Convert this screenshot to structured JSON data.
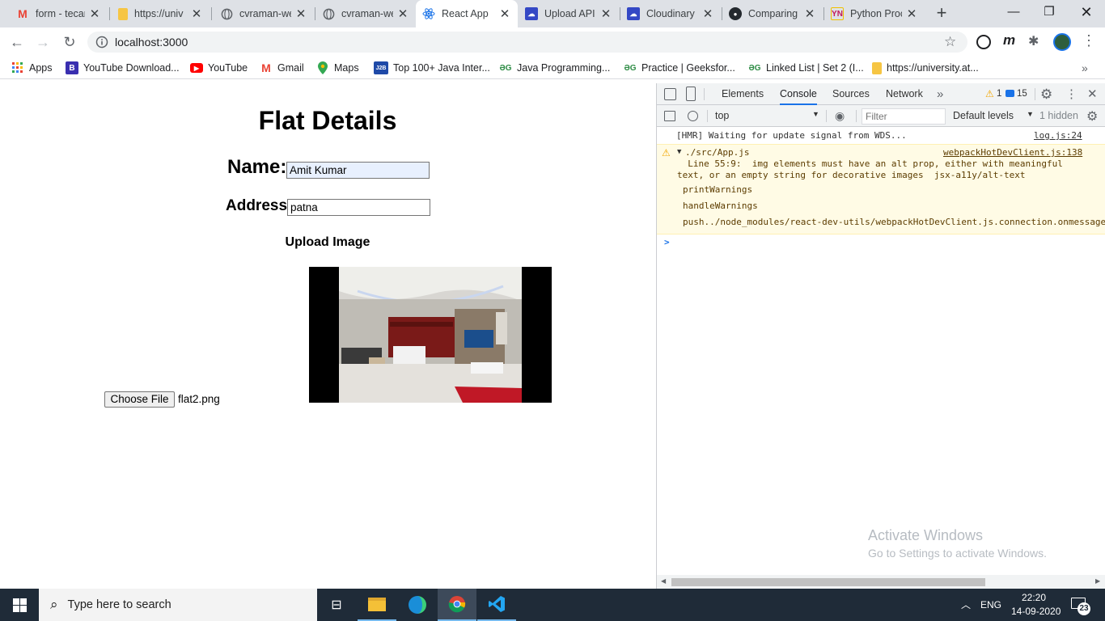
{
  "tabs": [
    {
      "label": "form - tecar",
      "icon": "gmail-icon",
      "active": false
    },
    {
      "label": "https://univ",
      "icon": "yellow-page-icon",
      "active": false
    },
    {
      "label": "cvraman-we",
      "icon": "globe-icon",
      "active": false
    },
    {
      "label": "cvraman-we",
      "icon": "globe-icon",
      "active": false
    },
    {
      "label": "React App",
      "icon": "react-icon",
      "active": true
    },
    {
      "label": "Upload API",
      "icon": "upload-api-icon",
      "active": false
    },
    {
      "label": "Cloudinary",
      "icon": "cloudinary-icon",
      "active": false
    },
    {
      "label": "Comparing",
      "icon": "github-icon",
      "active": false
    },
    {
      "label": "Python Proc",
      "icon": "python-icon",
      "active": false
    }
  ],
  "address_bar": {
    "url": "localhost:3000"
  },
  "bookmarks": {
    "apps_label": "Apps",
    "items": [
      {
        "label": "YouTube Download...",
        "icon": "b-icon"
      },
      {
        "label": "YouTube",
        "icon": "youtube-icon"
      },
      {
        "label": "Gmail",
        "icon": "gmail-icon"
      },
      {
        "label": "Maps",
        "icon": "maps-icon"
      },
      {
        "label": "Top 100+ Java Inter...",
        "icon": "j2b-icon"
      },
      {
        "label": "Java Programming...",
        "icon": "geeks-icon"
      },
      {
        "label": "Practice | Geeksfor...",
        "icon": "geeks-icon"
      },
      {
        "label": "Linked List | Set 2 (I...",
        "icon": "geeks-icon"
      },
      {
        "label": "https://university.at...",
        "icon": "yellow-page-icon"
      }
    ],
    "j2b_text": "J2B",
    "b_text": "B"
  },
  "page": {
    "title": "Flat Details",
    "name_label": "Name:",
    "name_value": "Amit Kumar",
    "address_label": "Address:",
    "address_value": "patna",
    "upload_label": "Upload Image",
    "choose_button": "Choose File",
    "file_name": "flat2.png"
  },
  "devtools": {
    "tabs": [
      "Elements",
      "Console",
      "Sources",
      "Network"
    ],
    "active_tab": "Console",
    "warn_count": "1",
    "msg_count": "15",
    "context": "top",
    "filter_placeholder": "Filter",
    "levels": "Default levels",
    "hidden": "1 hidden",
    "console": {
      "hmr_msg": "[HMR] Waiting for update signal from WDS...",
      "hmr_src": "log.js:24",
      "warn_file": "./src/App.js",
      "warn_src": "webpackHotDevClient.js:138",
      "warn_line1": "  Line 55:9:  img elements must have an alt prop, either with meaningful",
      "warn_line2": "text, or an empty string for decorative images  jsx-a11y/alt-text",
      "stack": [
        "printWarnings",
        "handleWarnings",
        "push../node_modules/react-dev-utils/webpackHotDevClient.js.connection.onmessage"
      ],
      "prompt": ">"
    }
  },
  "watermark": {
    "line1": "Activate Windows",
    "line2": "Go to Settings to activate Windows."
  },
  "taskbar": {
    "search_placeholder": "Type here to search",
    "lang": "ENG",
    "time": "22:20",
    "date": "14-09-2020",
    "notifications": "23"
  },
  "colors": {
    "tabstrip": "#dee1e6",
    "taskbar": "#1f2b38",
    "warn_bg": "#fffbe5",
    "devtools_link": "#1a73e8"
  }
}
